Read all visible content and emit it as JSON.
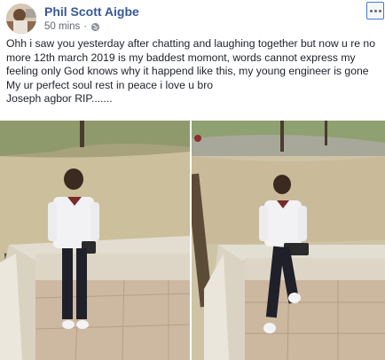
{
  "post": {
    "author": "Phil Scott Aigbe",
    "timestamp": "50 mins",
    "separator": "·",
    "privacy_icon": "globe-icon",
    "menu_icon": "more-options-icon",
    "text_line1": "Ohh i saw you yesterday after chatting and laughing together but now u re no more 12th march 2019 is my baddest momont, words cannot express my feeling only God knows why it happend like this, my young engineer is gone My ur perfect soul rest in peace i love u bro",
    "text_line2": "Joseph agbor RIP......."
  },
  "photos": [
    {
      "id": "photo-left",
      "icon": "photo"
    },
    {
      "id": "photo-right",
      "icon": "photo"
    }
  ]
}
